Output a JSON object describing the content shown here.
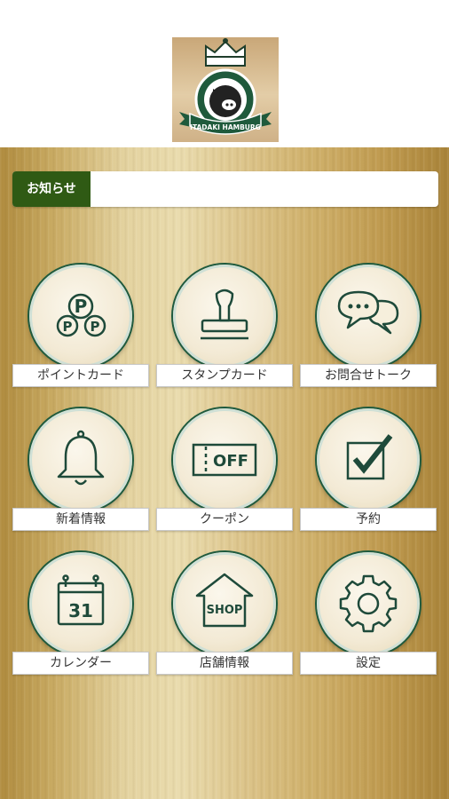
{
  "logo": {
    "text": "ITADAKI HAMBURG",
    "icon": "crown-pig-logo"
  },
  "notice": {
    "label": "お知らせ",
    "content": ""
  },
  "menu": [
    {
      "label": "ポイントカード",
      "icon": "point-card-icon"
    },
    {
      "label": "スタンプカード",
      "icon": "stamp-icon"
    },
    {
      "label": "お問合せトーク",
      "icon": "chat-icon"
    },
    {
      "label": "新着情報",
      "icon": "bell-icon"
    },
    {
      "label": "クーポン",
      "icon": "coupon-icon",
      "icon_text": "OFF"
    },
    {
      "label": "予約",
      "icon": "checkbox-icon"
    },
    {
      "label": "カレンダー",
      "icon": "calendar-icon",
      "icon_text": "31"
    },
    {
      "label": "店舗情報",
      "icon": "shop-icon",
      "icon_text": "SHOP"
    },
    {
      "label": "設定",
      "icon": "gear-icon"
    }
  ],
  "colors": {
    "accent_green": "#2f5a14",
    "icon_stroke": "#1e4a3a"
  }
}
